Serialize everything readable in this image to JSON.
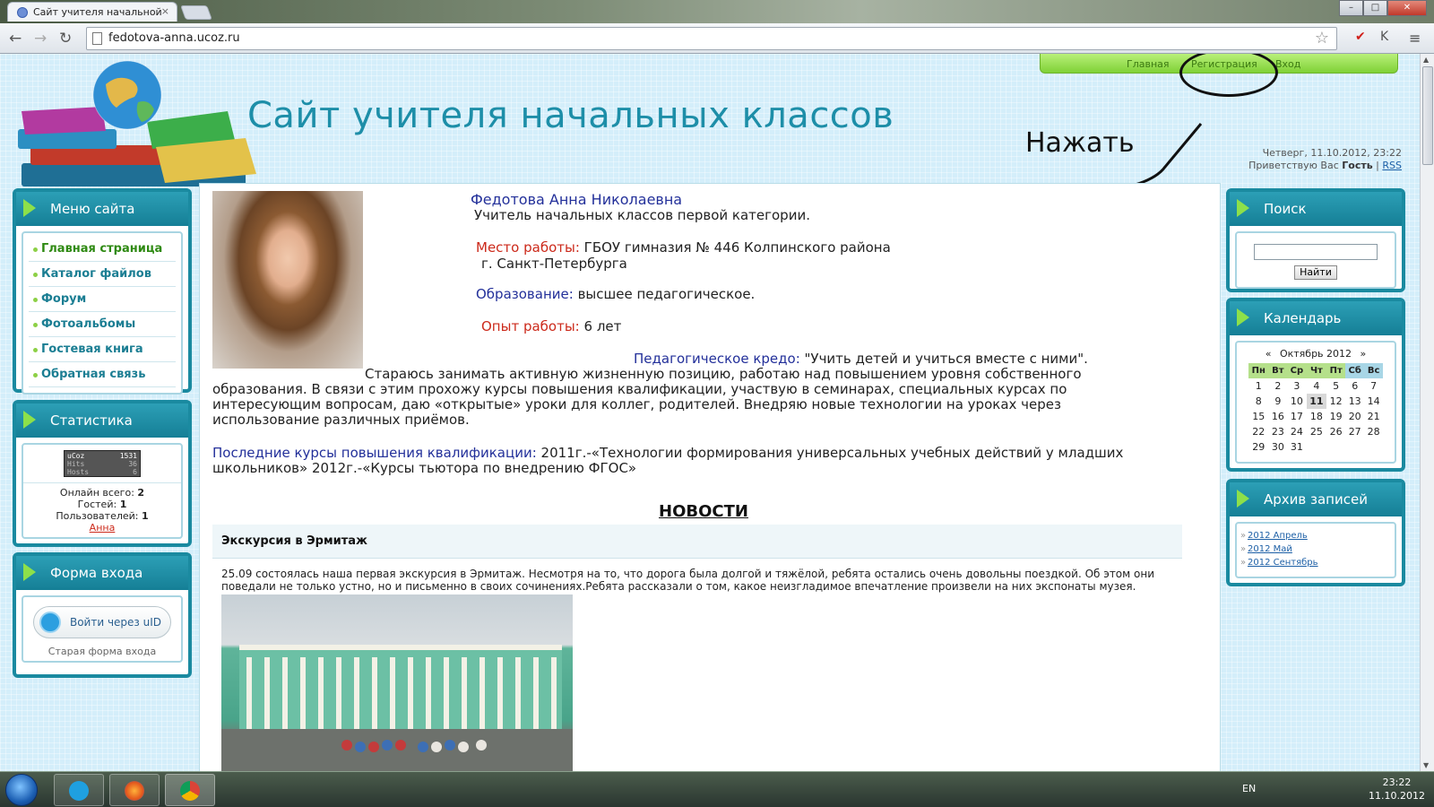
{
  "browser": {
    "tab_title": "Сайт учителя начальной",
    "url": "fedotova-anna.ucoz.ru"
  },
  "header": {
    "site_title": "Сайт учителя начальных классов",
    "nav": [
      "Главная",
      "Регистрация",
      "Вход"
    ],
    "annotation": "Нажать",
    "date_line": "Четверг, 11.10.2012, 23:22",
    "greeting_prefix": "Приветствую Вас ",
    "greeting_user": "Гость",
    "rss": "RSS"
  },
  "left": {
    "menu_title": "Меню сайта",
    "menu": [
      "Главная страница",
      "Каталог файлов",
      "Форум",
      "Фотоальбомы",
      "Гостевая книга",
      "Обратная связь"
    ],
    "stats_title": "Статистика",
    "counter": {
      "label": "uCoz",
      "value": "1531",
      "hits": "Hits",
      "hits_val": "36",
      "hosts": "Hosts",
      "hosts_val": "6"
    },
    "online_label": "Онлайн всего:",
    "online_val": "2",
    "guests_label": "Гостей:",
    "guests_val": "1",
    "users_label": "Пользователей:",
    "users_val": "1",
    "user_link": "Анна",
    "login_title": "Форма входа",
    "uid_button": "Войти через uID",
    "old_form": "Старая форма входа"
  },
  "main": {
    "name": "Федотова Анна Николаевна",
    "role": "Учитель начальных классов первой категории.",
    "work_label": "Место работы:",
    "work_value": "ГБОУ  гимназия № 446 Колпинского района",
    "work_city": "г. Санкт-Петербурга",
    "edu_label": "Образование:",
    "edu_value": "высшее педагогическое.",
    "exp_label": "Опыт работы:",
    "exp_value": "6 лет",
    "credo_label": "Педагогическое кредо:",
    "credo_value": "\"Учить детей и учиться вместе с ними\".",
    "para1_line1": "Стараюсь занимать активную жизненную позицию, работаю над повышением уровня собственного",
    "para1_rest": "образования. В связи с этим прохожу курсы повышения квалификации, участвую в семинарах, специальных курсах по интересующим вопросам, даю «открытые» уроки для коллег, родителей. Внедряю новые технологии на уроках через использование различных приёмов.",
    "courses_label": "Последние курсы повышения квалификации:",
    "courses_value": "2011г.-«Технологии формирования универсальных учебных действий у младших школьников» 2012г.-«Курсы тьютора по внедрению ФГОС»",
    "news_heading": "НОВОСТИ",
    "news_title": "Экскурсия в Эрмитаж",
    "news_text": "25.09 состоялась наша первая экскурсия в Эрмитаж. Несмотря на то, что дорога была долгой и тяжёлой, ребята остались очень довольны поездкой. Об этом они поведали не только устно, но и письменно в своих сочинениях.Ребята рассказали о том, какое неизгладимое впечатление произвели на них экспонаты музея."
  },
  "right": {
    "search_title": "Поиск",
    "search_button": "Найти",
    "calendar_title": "Календарь",
    "cal_prev": "«",
    "cal_month": "Октябрь 2012",
    "cal_next": "»",
    "weekdays": [
      "Пн",
      "Вт",
      "Ср",
      "Чт",
      "Пт",
      "Сб",
      "Вс"
    ],
    "weeks": [
      [
        "1",
        "2",
        "3",
        "4",
        "5",
        "6",
        "7"
      ],
      [
        "8",
        "9",
        "10",
        "11",
        "12",
        "13",
        "14"
      ],
      [
        "15",
        "16",
        "17",
        "18",
        "19",
        "20",
        "21"
      ],
      [
        "22",
        "23",
        "24",
        "25",
        "26",
        "27",
        "28"
      ],
      [
        "29",
        "30",
        "31",
        "",
        "",
        "",
        ""
      ]
    ],
    "today": "11",
    "archive_title": "Архив записей",
    "archive": [
      "2012 Апрель",
      "2012 Май",
      "2012 Сентябрь"
    ]
  },
  "taskbar": {
    "lang": "EN",
    "time": "23:22",
    "date": "11.10.2012"
  }
}
